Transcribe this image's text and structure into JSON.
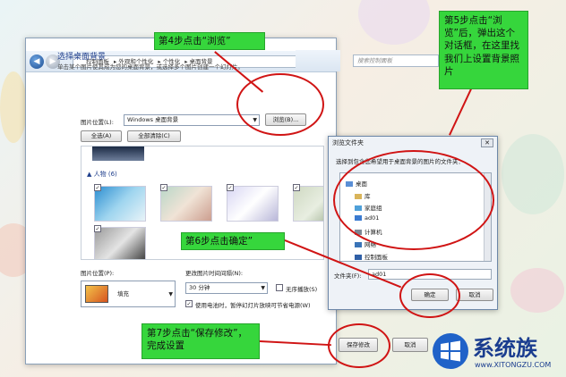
{
  "window": {
    "breadcrumbs": [
      "控制面板",
      "外观和个性化",
      "个性化",
      "桌面背景"
    ],
    "search_placeholder": "搜索控制面板",
    "heading": "选择桌面背景",
    "subheading": "单击某个图片使其成为您的桌面背景，或选择多个图片创建一个幻灯片。",
    "picture_location_label": "图片位置(L):",
    "picture_location_value": "Windows 桌面背景",
    "browse_button": "浏览(B)...",
    "select_all_button": "全选(A)",
    "clear_all_button": "全部清除(C)",
    "group_label": "▲ 人物 (6)",
    "position_label": "图片位置(P):",
    "position_value": "填充",
    "interval_label": "更改图片时间间隔(N):",
    "interval_value": "30 分钟",
    "shuffle_label": "无序播放(S)",
    "battery_label": "使用电池时，暂停幻灯片放映可节省电源(W)",
    "save_button": "保存修改",
    "cancel_button": "取消"
  },
  "dialog": {
    "title": "浏览文件夹",
    "prompt": "选择到包含您希望用于桌面背景的图片的文件夹：",
    "tree": [
      "桌面",
      "库",
      "家庭组",
      "ad01",
      "计算机",
      "网络",
      "控制面板"
    ],
    "folder_label": "文件夹(F):",
    "folder_value": "ad01",
    "ok_button": "确定",
    "cancel_button": "取消"
  },
  "callouts": {
    "step4": "第4步点击“浏览”",
    "step5": "第5步点击“浏览”后，弹出这个对话框，在这里找我们上设置背景照片",
    "step6": "第6步点击确定”",
    "step7": "第7步点击“保存修改”，完成设置"
  },
  "logo": {
    "name": "系统族",
    "url": "www.XITONGZU.COM"
  },
  "colors": {
    "callout_green": "#36d63c",
    "annotation_red": "#d01414",
    "heading_blue": "#1e3e8c"
  }
}
